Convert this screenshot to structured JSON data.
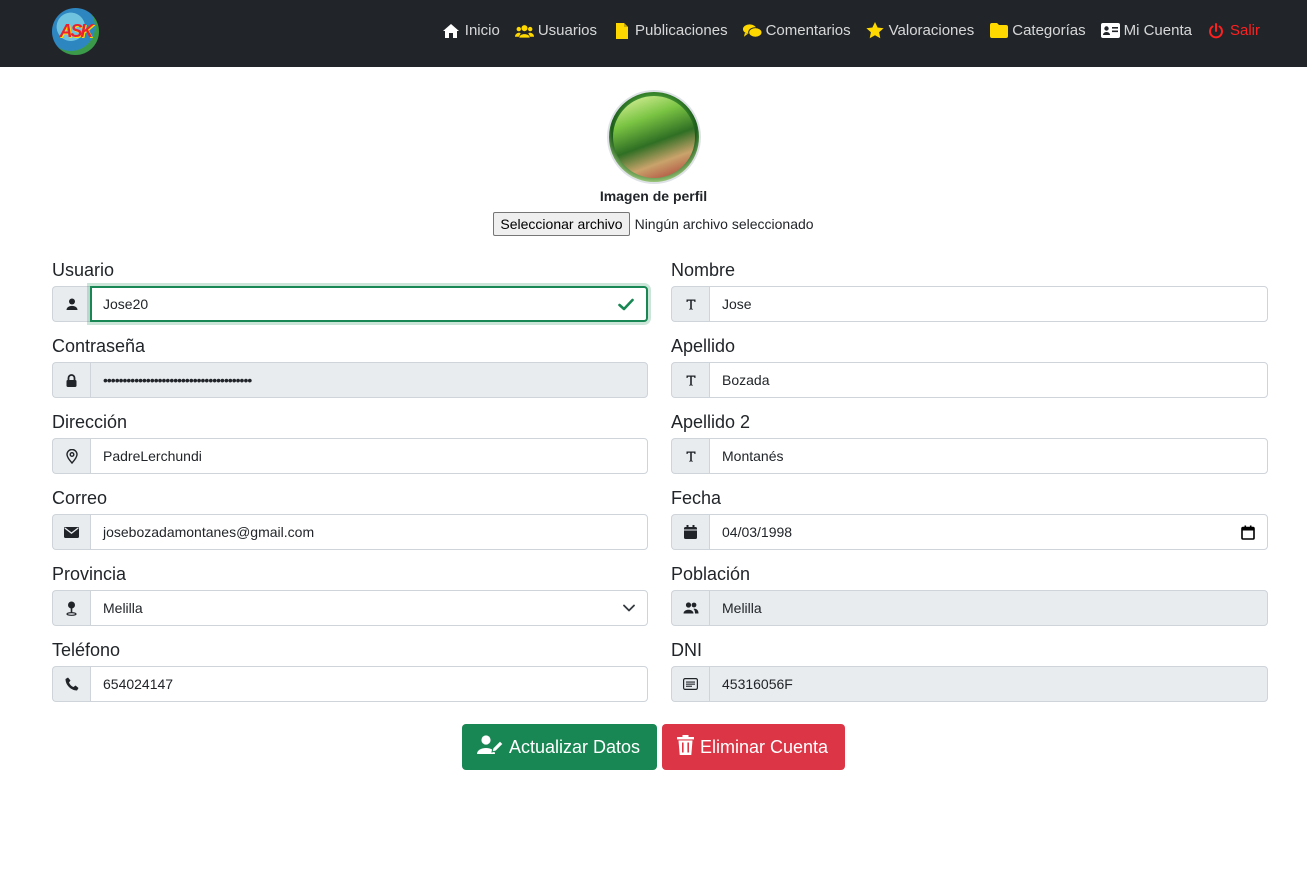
{
  "navbar": {
    "logo_text": "ASK",
    "items": [
      {
        "label": "Inicio",
        "icon": "home-icon"
      },
      {
        "label": "Usuarios",
        "icon": "users-icon"
      },
      {
        "label": "Publicaciones",
        "icon": "file-icon"
      },
      {
        "label": "Comentarios",
        "icon": "comments-icon"
      },
      {
        "label": "Valoraciones",
        "icon": "star-icon"
      },
      {
        "label": "Categorías",
        "icon": "folder-icon"
      },
      {
        "label": "Mi Cuenta",
        "icon": "id-card-icon"
      },
      {
        "label": "Salir",
        "icon": "power-icon"
      }
    ],
    "accent_yellow": "#ffd800",
    "danger_color": "#ff2020"
  },
  "profile": {
    "label": "Imagen de perfil",
    "file_button": "Seleccionar archivo",
    "file_status": "Ningún archivo seleccionado"
  },
  "form": {
    "usuario": {
      "label": "Usuario",
      "value": "Jose20"
    },
    "nombre": {
      "label": "Nombre",
      "value": "Jose"
    },
    "contrasena": {
      "label": "Contraseña",
      "value": "••••••••••••••••••••••••••••••••••••••"
    },
    "apellido": {
      "label": "Apellido",
      "value": "Bozada"
    },
    "direccion": {
      "label": "Dirección",
      "value": "PadreLerchundi"
    },
    "apellido2": {
      "label": "Apellido 2",
      "value": "Montanés"
    },
    "correo": {
      "label": "Correo",
      "value": "josebozadamontanes@gmail.com"
    },
    "fecha": {
      "label": "Fecha",
      "value": "04/03/1998"
    },
    "provincia": {
      "label": "Provincia",
      "value": "Melilla"
    },
    "poblacion": {
      "label": "Población",
      "value": "Melilla"
    },
    "telefono": {
      "label": "Teléfono",
      "value": "654024147"
    },
    "dni": {
      "label": "DNI",
      "value": "45316056F"
    }
  },
  "actions": {
    "update": "Actualizar Datos",
    "delete": "Eliminar Cuenta",
    "update_color": "#198754",
    "delete_color": "#dc3545"
  }
}
